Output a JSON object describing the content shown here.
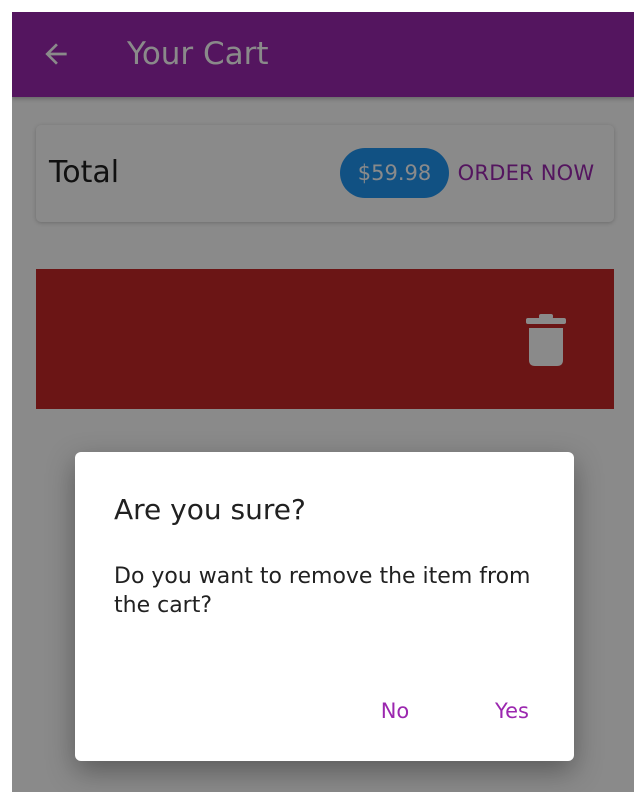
{
  "app_bar": {
    "title": "Your Cart",
    "back_icon": "arrow-left-icon"
  },
  "cart_summary": {
    "total_label": "Total",
    "total_amount": "$59.98",
    "order_button_label": "ORDER NOW"
  },
  "cart_item_swipe": {
    "delete_icon": "trash-icon"
  },
  "confirm_dialog": {
    "title": "Are you sure?",
    "message": "Do you want to remove the item from the cart?",
    "no_label": "No",
    "yes_label": "Yes"
  },
  "colors": {
    "app_bar": "#9b27af",
    "app_bar_text": "#ffffff",
    "chip": "#2196f3",
    "chip_text": "#ffffff",
    "accent": "#9b27af",
    "danger": "#c62828",
    "icon_on_danger": "#ffffff",
    "text_primary": "#212121"
  }
}
